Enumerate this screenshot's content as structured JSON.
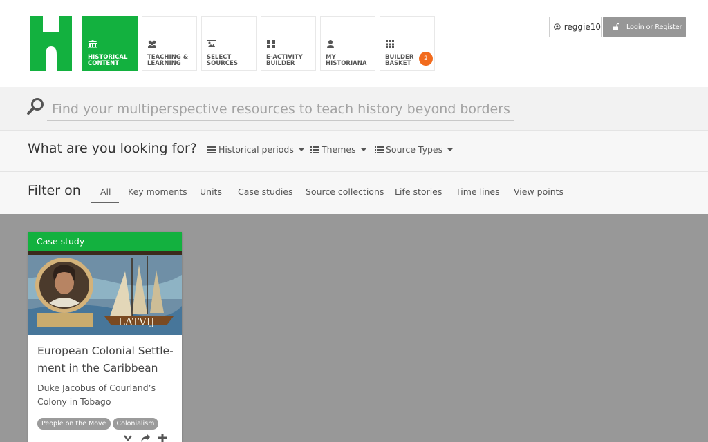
{
  "nav": {
    "items": [
      {
        "label": "HISTORICAL CONTENT",
        "icon": "museum-icon",
        "active": true
      },
      {
        "label": "TEACHING & LEARNING",
        "icon": "users-icon"
      },
      {
        "label": "SELECT SOURCES",
        "icon": "image-icon"
      },
      {
        "label": "E-ACTIVITY BUILDER",
        "icon": "grid4-icon"
      },
      {
        "label": "MY HISTORIANA",
        "icon": "user-icon"
      },
      {
        "label": "BUILDER BASKET",
        "icon": "grid9-icon",
        "badge": "2"
      }
    ]
  },
  "user": {
    "name": "reggie10",
    "login_label": "Login or Register"
  },
  "search": {
    "placeholder": "Find your multiperspective resources to teach history beyond borders"
  },
  "looking": {
    "title": "What are you looking for?",
    "dropdowns": [
      "Historical periods",
      "Themes",
      "Source Types"
    ]
  },
  "filter": {
    "title": "Filter on",
    "tabs": [
      "All",
      "Key moments",
      "Units",
      "Case studies",
      "Source collections",
      "Life stories",
      "Time lines",
      "View points"
    ],
    "active": "All"
  },
  "card": {
    "type": "Case study",
    "title_line1": "European Colonial Settle-",
    "title_line2": "ment in the Caribbean",
    "subtitle_line1": "Duke Jacobus of Courland’s",
    "subtitle_line2": "Colony in Tobago",
    "image_text": "LATVIJ",
    "tags": [
      "People on the Move",
      "Colonialism"
    ]
  },
  "colors": {
    "brand_green": "#13b13f",
    "badge_orange": "#f26b1d",
    "content_bg": "#989898"
  }
}
